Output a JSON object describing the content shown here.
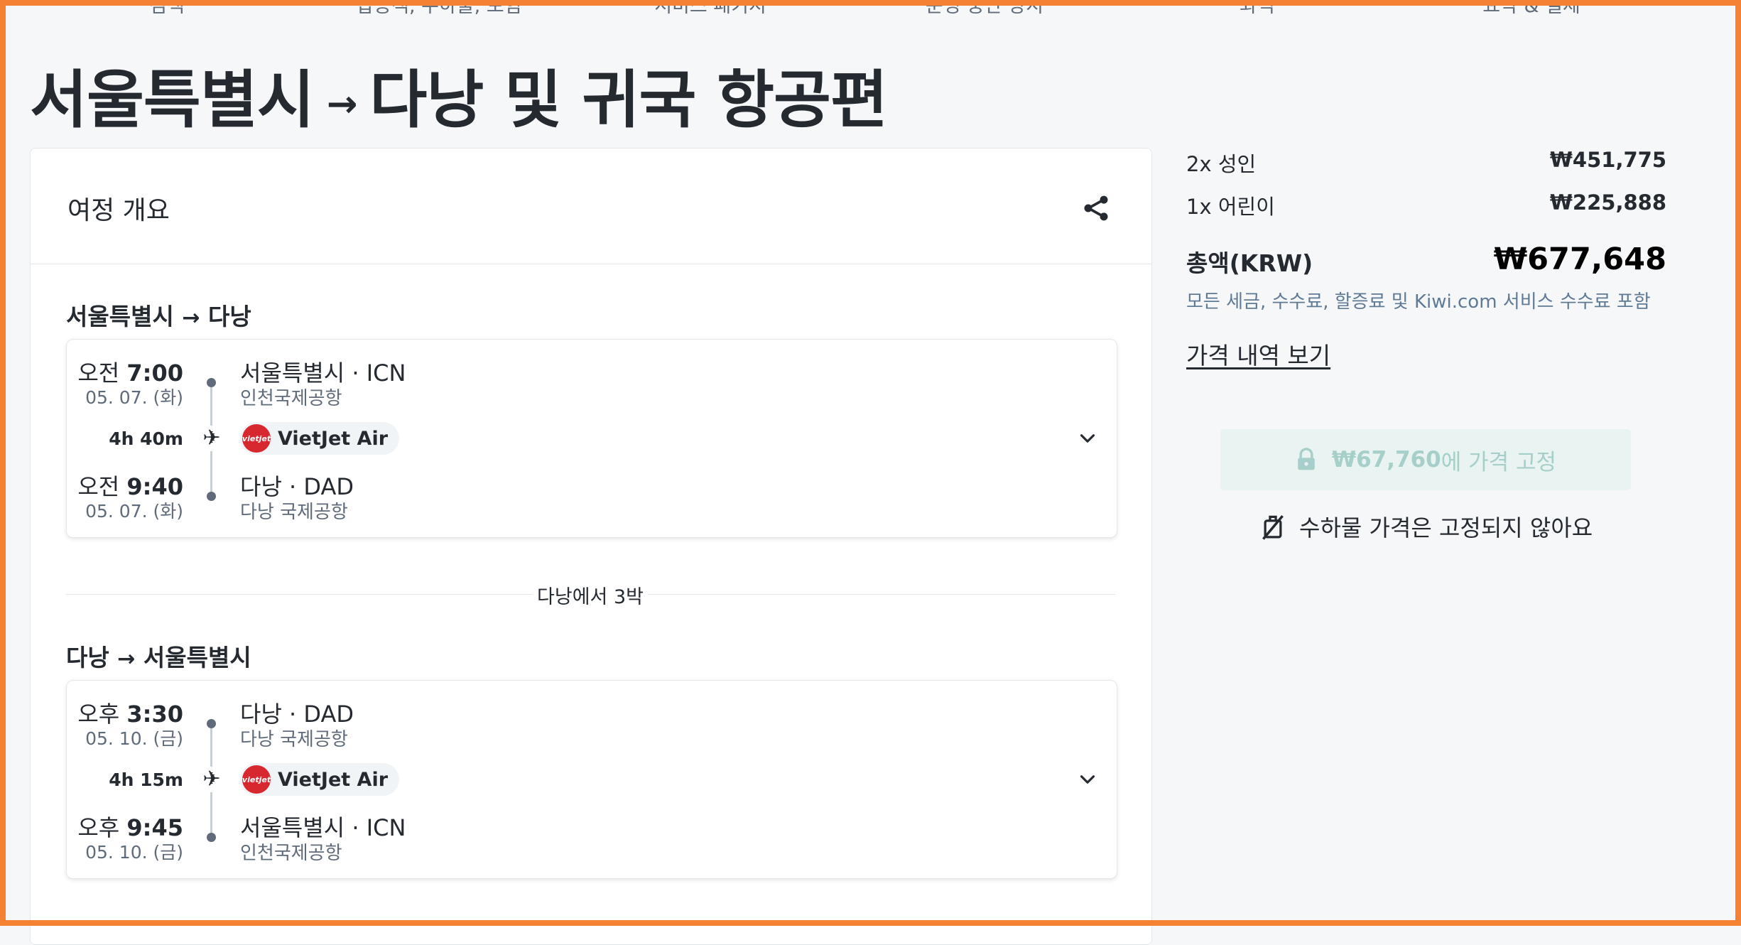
{
  "steps": [
    "검색",
    "탑승객, 수하물, 보험",
    "서비스 패키지",
    "운영 중단 방지",
    "좌석",
    "요약 & 결제"
  ],
  "page_title": {
    "origin": "서울특별시",
    "arrow": "→",
    "destination": "다낭 및 귀국 항공편"
  },
  "itinerary": {
    "title": "여정 개요",
    "share_icon": "share-icon",
    "legs": [
      {
        "heading": {
          "from": "서울특별시",
          "arrow": "→",
          "to": "다낭"
        },
        "depart": {
          "period": "오전",
          "time": "7:00",
          "date": "05. 07. (화)",
          "city": "서울특별시 · ICN",
          "airport": "인천국제공항"
        },
        "duration": "4h 40m",
        "carrier": {
          "logo": "vietjet",
          "name": "VietJet Air"
        },
        "arrive": {
          "period": "오전",
          "time": "9:40",
          "date": "05. 07. (화)",
          "city": "다낭 · DAD",
          "airport": "다낭 국제공항"
        }
      },
      {
        "heading": {
          "from": "다낭",
          "arrow": "→",
          "to": "서울특별시"
        },
        "depart": {
          "period": "오후",
          "time": "3:30",
          "date": "05. 10. (금)",
          "city": "다낭 · DAD",
          "airport": "다낭 국제공항"
        },
        "duration": "4h 15m",
        "carrier": {
          "logo": "vietjet",
          "name": "VietJet Air"
        },
        "arrive": {
          "period": "오후",
          "time": "9:45",
          "date": "05. 10. (금)",
          "city": "서울특별시 · ICN",
          "airport": "인천국제공항"
        }
      }
    ],
    "stay": "다낭에서 3박"
  },
  "price": {
    "adults": {
      "label": "2x 성인",
      "value": "₩451,775"
    },
    "children": {
      "label": "1x 어린이",
      "value": "₩225,888"
    },
    "total_label": "총액(KRW)",
    "total_value": "₩677,648",
    "note": "모든 세금, 수수료, 할증료 및 Kiwi.com 서비스 수수료 포함",
    "breakdown_link": "가격 내역 보기",
    "lock": {
      "amount": "₩67,760",
      "suffix": "에 가격 고정"
    },
    "bag_note": "수하물 가격은 고정되지 않아요"
  },
  "colors": {
    "frame": "#f58233",
    "text": "#252a31",
    "muted": "#5f6b78",
    "lock_bg": "#e8f3f2",
    "lock_text": "#a7cfc9",
    "carrier": "#d7282f"
  }
}
